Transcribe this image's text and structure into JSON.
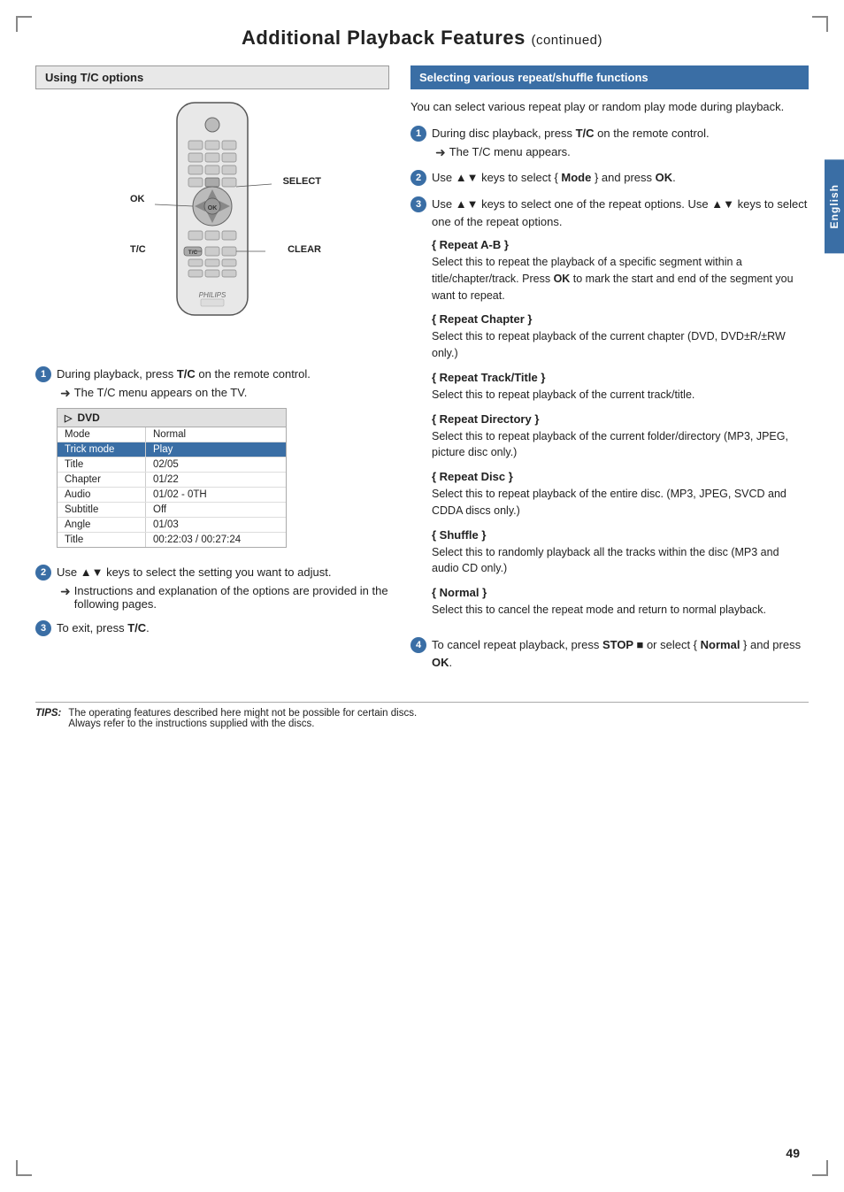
{
  "page": {
    "title": "Additional Playback Features",
    "title_continued": "(continued)",
    "page_number": "49"
  },
  "side_tab": {
    "label": "English"
  },
  "left_section": {
    "heading": "Using T/C options",
    "step1_text": "During playback, press ",
    "step1_bold": "T/C",
    "step1_text2": " on the remote control.",
    "step1_arrow": "The T/C menu appears on the TV.",
    "dvd_table": {
      "header": "DVD",
      "rows": [
        {
          "label": "Mode",
          "value": "Normal",
          "highlighted": false
        },
        {
          "label": "Trick mode",
          "value": "Play",
          "highlighted": true
        },
        {
          "label": "Title",
          "value": "02/05",
          "highlighted": false
        },
        {
          "label": "Chapter",
          "value": "01/22",
          "highlighted": false
        },
        {
          "label": "Audio",
          "value": "01/02 - 0TH",
          "highlighted": false
        },
        {
          "label": "Subtitle",
          "value": "Off",
          "highlighted": false
        },
        {
          "label": "Angle",
          "value": "01/03",
          "highlighted": false
        },
        {
          "label": "Title",
          "value": "00:22:03 / 00:27:24",
          "highlighted": false
        }
      ]
    },
    "step2_text": "Use ▲▼ keys to select the setting you want to adjust.",
    "step2_arrow": "Instructions and explanation of the options are provided in the following pages.",
    "step3_text": "To exit, press ",
    "step3_bold": "T/C",
    "step3_end": "."
  },
  "right_section": {
    "heading": "Selecting various repeat/shuffle functions",
    "intro": "You can select various repeat play or random play mode during playback.",
    "step1_text": "During disc playback, press ",
    "step1_bold": "T/C",
    "step1_text2": " on the remote control.",
    "step1_arrow": "The T/C menu appears.",
    "step2_text": "Use ▲▼ keys to select { ",
    "step2_bold": "Mode",
    "step2_text2": " } and press ",
    "step2_bold2": "OK",
    "step2_end": ".",
    "step3_text": "Use ▲▼ keys to select one of the repeat options.",
    "repeat_items": [
      {
        "title": "Repeat A-B",
        "body": "Select this to repeat the playback of a specific segment within a title/chapter/track. Press OK to mark the start and end of the segment you want to repeat."
      },
      {
        "title": "Repeat Chapter",
        "body": "Select this to repeat playback of the current chapter (DVD, DVD±R/±RW only.)"
      },
      {
        "title": "Repeat Track/Title",
        "body": "Select this to repeat playback of the current track/title."
      },
      {
        "title": "Repeat Directory",
        "body": "Select this to repeat playback of the current folder/directory (MP3, JPEG, picture disc only.)"
      },
      {
        "title": "Repeat Disc",
        "body": "Select this to repeat playback of the entire disc. (MP3, JPEG, SVCD and CDDA discs only.)"
      },
      {
        "title": "Shuffle",
        "body": "Select this to randomly playback all the tracks within the disc (MP3 and audio CD only.)"
      },
      {
        "title": "Normal",
        "body": "Select this to cancel the repeat mode and return to normal playback."
      }
    ],
    "step4_text": "To cancel repeat playback, press ",
    "step4_bold": "STOP ■",
    "step4_text2": " or select { ",
    "step4_bold2": "Normal",
    "step4_text3": " } and press ",
    "step4_bold3": "OK",
    "step4_end": "."
  },
  "tips": {
    "label": "TIPS:",
    "lines": [
      "The operating features described here might not be possible for certain discs.",
      "Always refer to the instructions supplied with the discs."
    ]
  },
  "remote_labels": {
    "ok": "OK",
    "select": "SELECT",
    "tc": "T/C",
    "clear": "CLEAR"
  }
}
